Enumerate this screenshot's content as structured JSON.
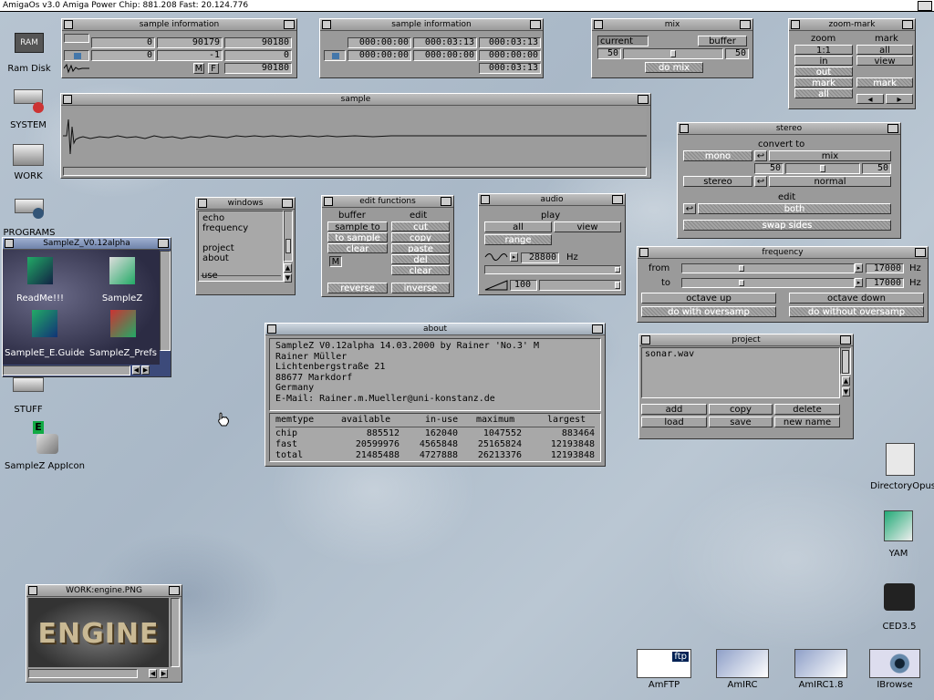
{
  "screen": {
    "title": "AmigaOs v3.0  Amiga Power   Chip: 881.208  Fast: 20.124.776"
  },
  "sample_info_1": {
    "title": "sample information",
    "row1": [
      "0",
      "90179",
      "90180"
    ],
    "row2": [
      "0",
      "-1",
      "0"
    ],
    "row3_btn_m": "M",
    "row3_btn_f": "F",
    "row3_value": "90180"
  },
  "sample_info_2": {
    "title": "sample information",
    "row1": [
      "000:00:00",
      "000:03:13",
      "000:03:13"
    ],
    "row2": [
      "000:00:00",
      "000:00:00",
      "000:00:00"
    ],
    "row3_value": "000:03:13"
  },
  "mix": {
    "title": "mix",
    "current": "current",
    "buffer": "buffer",
    "left_value": "50",
    "right_value": "50",
    "slider_level": 0.5,
    "do_mix": "do mix"
  },
  "zoom_mark": {
    "title": "zoom-mark",
    "zoom": "zoom",
    "mark": "mark",
    "zoom_items": [
      "1:1",
      "in",
      "out",
      "mark",
      "all"
    ],
    "mark_items": [
      "all",
      "view",
      "",
      "mark"
    ]
  },
  "sample": {
    "title": "sample"
  },
  "stereo": {
    "title": "stereo",
    "convert_to": "convert to",
    "mono": "mono",
    "mix": "mix",
    "mix_left": "50",
    "mix_right": "50",
    "stereo": "stereo",
    "normal": "normal",
    "edit": "edit",
    "both": "both",
    "swap_sides": "swap sides"
  },
  "windows_list": {
    "title": "windows",
    "items": [
      "echo",
      "frequency",
      "",
      "project",
      "about",
      "",
      "use"
    ]
  },
  "edit_functions": {
    "title": "edit functions",
    "buffer": "buffer",
    "edit": "edit",
    "buffer_items": [
      "sample to",
      "to sample",
      "clear",
      "M"
    ],
    "edit_items": [
      "cut",
      "copy",
      "paste",
      "del",
      "clear"
    ],
    "reverse": "reverse",
    "inverse": "inverse"
  },
  "audio": {
    "title": "audio",
    "play": "play",
    "all": "all",
    "view": "view",
    "range": "range",
    "rate": "28800",
    "rate_unit": "Hz",
    "volume": "100"
  },
  "frequency": {
    "title": "frequency",
    "from": "from",
    "to": "to",
    "from_value": "17000",
    "to_value": "17000",
    "unit": "Hz",
    "octave_up": "octave up",
    "octave_down": "octave down",
    "do_with": "do with oversamp",
    "do_without": "do without oversamp"
  },
  "about": {
    "title": "about",
    "lines": [
      "SampleZ V0.12alpha  14.03.2000  by Rainer 'No.3' M",
      "Rainer Müller",
      "Lichtenbergstraße 21",
      "88677 Markdorf",
      "Germany",
      "E-Mail: Rainer.m.Mueller@uni-konstanz.de"
    ],
    "mem_headers": [
      "memtype",
      "available",
      "in-use",
      "maximum",
      "largest"
    ],
    "mem_rows": [
      [
        "chip",
        "885512",
        "162040",
        "1047552",
        "883464"
      ],
      [
        "fast",
        "20599976",
        "4565848",
        "25165824",
        "12193848"
      ],
      [
        "total",
        "21485488",
        "4727888",
        "26213376",
        "12193848"
      ]
    ]
  },
  "project": {
    "title": "project",
    "items": [
      "sonar.wav"
    ],
    "add": "add",
    "copy": "copy",
    "delete": "delete",
    "load": "load",
    "save": "save",
    "new_name": "new name"
  },
  "drawer": {
    "title": "SampleZ_V0.12alpha",
    "items": [
      "ReadMe!!!",
      "SampleZ",
      "SampleE_E.Guide",
      "SampleZ_Prefs"
    ]
  },
  "engine_window": {
    "title": "WORK:engine.PNG",
    "image_text": "ENGINE"
  },
  "desktop_icons": {
    "ram": "Ram Disk",
    "ram_badge": "RAM",
    "system": "SYSTEM",
    "work": "WORK",
    "programs": "PROGRAMS",
    "stuff": "STUFF",
    "appicon": "SampleZ AppIcon",
    "dopus": "DirectoryOpus",
    "yam": "YAM",
    "ced": "CED3.5",
    "amftp": "AmFTP",
    "amirc": "AmIRC",
    "amirc18": "AmIRC1.8",
    "ibrowse": "IBrowse",
    "ftp_badge": "ftp"
  }
}
